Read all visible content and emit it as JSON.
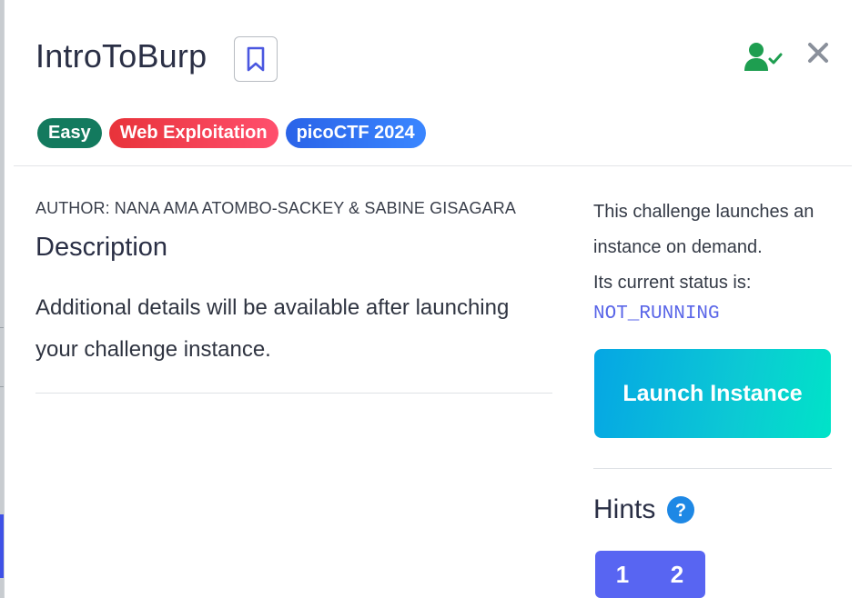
{
  "challenge": {
    "title": "IntroToBurp",
    "tags": [
      "Easy",
      "Web Exploitation",
      "picoCTF 2024"
    ],
    "author": "AUTHOR: NANA AMA ATOMBO-SACKEY & SABINE GISAGARA"
  },
  "description": {
    "heading": "Description",
    "text": "Additional details will be available after launching your challenge instance."
  },
  "instance": {
    "intro": "This challenge launches an instance on demand.",
    "status_label": "Its current status is:",
    "status": "NOT_RUNNING",
    "launch_label": "Launch Instance"
  },
  "hints": {
    "heading": "Hints",
    "buttons": [
      "1",
      "2"
    ]
  },
  "icons": {
    "bookmark": "bookmark-icon",
    "solved": "user-check-icon",
    "close": "close-icon",
    "help": "question-circle-icon"
  },
  "colors": {
    "easy": "#137a5e",
    "web_exploitation": "#f03e4e",
    "event": "#2f72f0",
    "status": "#5a66e8",
    "launch_start": "#05a6e4",
    "launch_end": "#00e3c8",
    "hint_buttons": "#5865f2",
    "solved_icon": "#1e9e50"
  }
}
